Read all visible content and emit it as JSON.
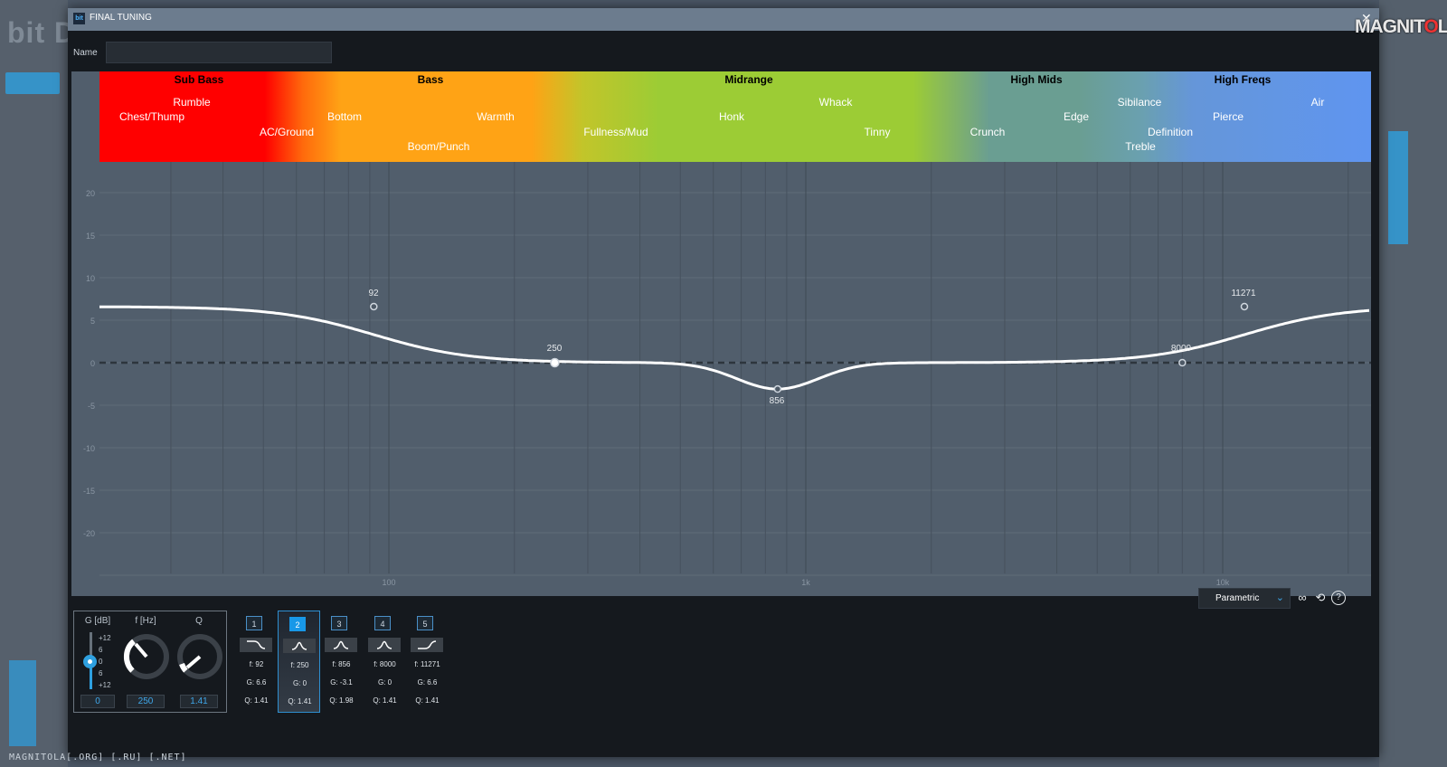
{
  "background": {
    "brand_text": "bit D",
    "watermark_bottom": "MAGNITOLA[.ORG] [.RU] [.NET]",
    "logo_text_a": "MAGNIT",
    "logo_text_b": "O",
    "logo_text_c": "LA"
  },
  "window": {
    "icon_text": "bit",
    "title": "FINAL TUNING",
    "close_glyph": "✕"
  },
  "name_field": {
    "label": "Name",
    "value": ""
  },
  "bands": {
    "headers": [
      "Sub Bass",
      "Bass",
      "Midrange",
      "High Mids",
      "High Freqs"
    ],
    "descriptors": [
      "Rumble",
      "Chest/Thump",
      "AC/Ground",
      "Bottom",
      "Boom/Punch",
      "Warmth",
      "Fullness/Mud",
      "Honk",
      "Whack",
      "Tinny",
      "Crunch",
      "Edge",
      "Sibilance",
      "Treble",
      "Definition",
      "Pierce",
      "Air"
    ]
  },
  "graph": {
    "y_ticks": [
      "20",
      "15",
      "10",
      "5",
      "0",
      "-5",
      "-10",
      "-15",
      "-20"
    ],
    "x_ticks": [
      "100",
      "1k",
      "10k"
    ],
    "points": [
      {
        "label": "92",
        "f": 92,
        "g": 6.6
      },
      {
        "label": "250",
        "f": 250,
        "g": 0
      },
      {
        "label": "856",
        "f": 856,
        "g": -3.1
      },
      {
        "label": "8000",
        "f": 8000,
        "g": 0
      },
      {
        "label": "11271",
        "f": 11271,
        "g": 6.6
      }
    ],
    "curve_color": "#ffffff"
  },
  "toolbar": {
    "mode": "Parametric",
    "chevron": "⌄",
    "icon_link": "∞",
    "icon_reset": "⟲",
    "icon_help": "?"
  },
  "controls": {
    "gain_label": "G [dB]",
    "freq_label": "f [Hz]",
    "q_label": "Q",
    "slider_ticks": [
      "+12",
      "6",
      "0",
      "6",
      "+12"
    ],
    "gain_value": "0",
    "freq_value": "250",
    "q_value": "1.41"
  },
  "filters": [
    {
      "num": "1",
      "type": "low-shelf",
      "f": "f:  92",
      "g": "G:  6.6",
      "q": "Q:  1.41"
    },
    {
      "num": "2",
      "type": "peak",
      "f": "f:  250",
      "g": "G:  0",
      "q": "Q:  1.41"
    },
    {
      "num": "3",
      "type": "peak",
      "f": "f:  856",
      "g": "G:  -3.1",
      "q": "Q:  1.98"
    },
    {
      "num": "4",
      "type": "peak",
      "f": "f:  8000",
      "g": "G:  0",
      "q": "Q:  1.41"
    },
    {
      "num": "5",
      "type": "high-shelf",
      "f": "f:  11271",
      "g": "G:  6.6",
      "q": "Q:  1.41"
    }
  ],
  "colors": {
    "accent": "#1898e8",
    "sub_bass": "#ff0000",
    "bass": "#ffa315",
    "midrange": "#9ccc35",
    "high_mids": "#6a9e92",
    "high_freqs": "#5f95f0"
  }
}
